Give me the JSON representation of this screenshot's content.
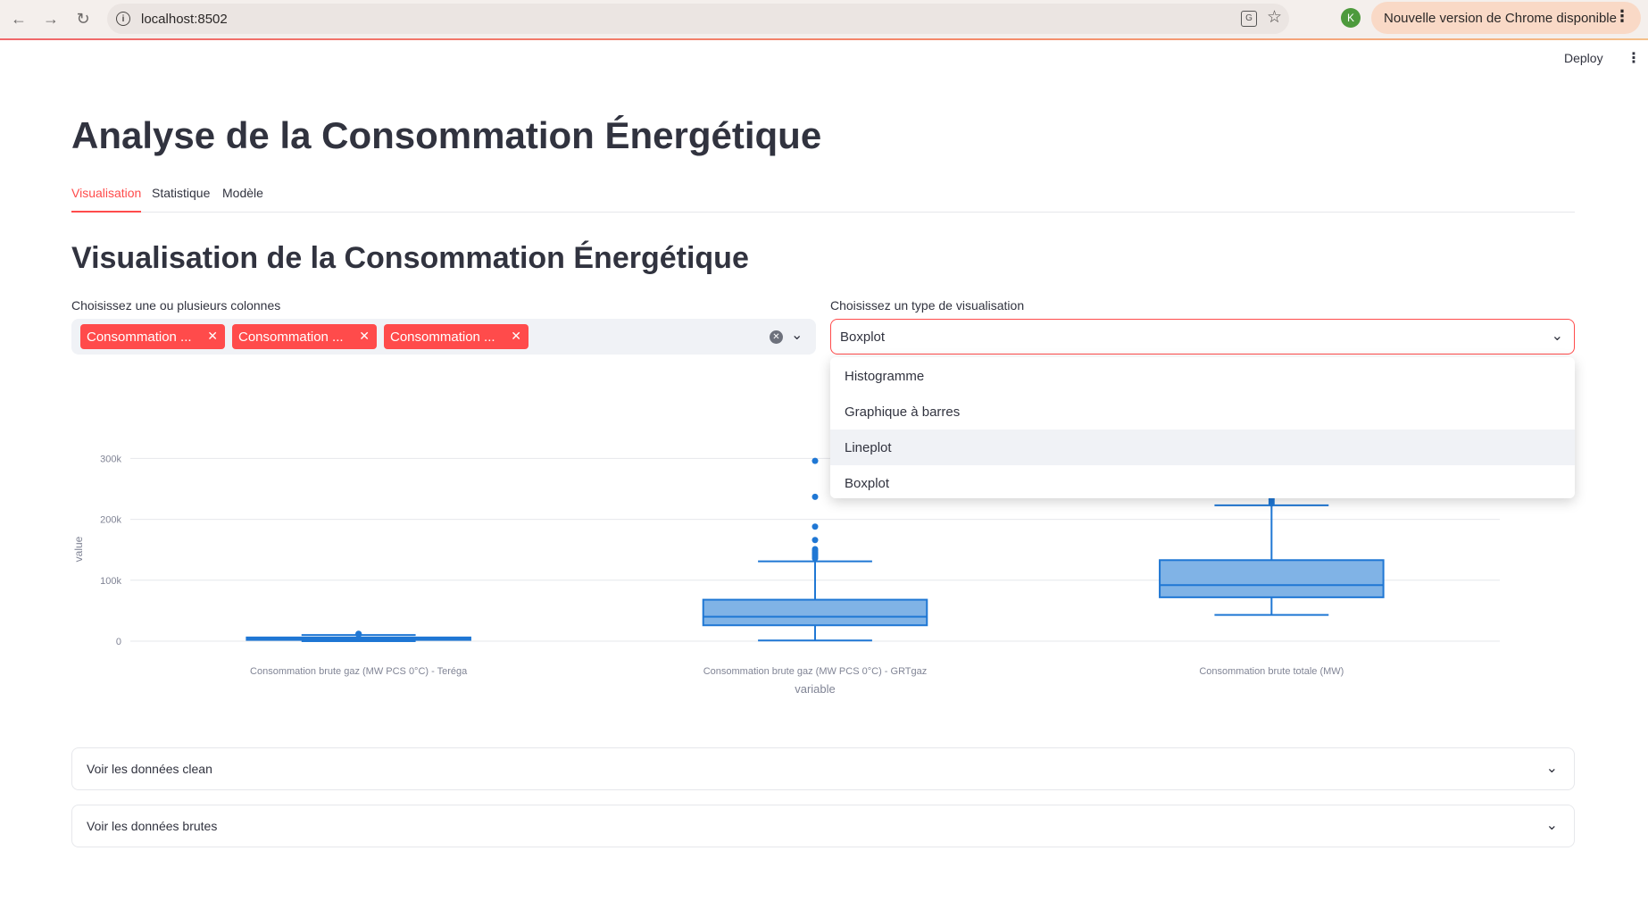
{
  "browser": {
    "url": "localhost:8502",
    "update_label": "Nouvelle version de Chrome disponible",
    "profile_initial": "K",
    "icons": [
      "back-icon",
      "forward-icon",
      "reload-icon",
      "site-info-icon",
      "translate-icon",
      "star-icon",
      "menu-dots-icon"
    ]
  },
  "header": {
    "deploy_label": "Deploy"
  },
  "app": {
    "title": "Analyse de la Consommation Énergétique",
    "tabs": [
      {
        "label": "Visualisation",
        "active": true
      },
      {
        "label": "Statistique",
        "active": false
      },
      {
        "label": "Modèle",
        "active": false
      }
    ],
    "section_title": "Visualisation de la Consommation Énergétique"
  },
  "columns_select": {
    "label": "Choisissez une ou plusieurs colonnes",
    "chips": [
      "Consommation ...",
      "Consommation ...",
      "Consommation ..."
    ]
  },
  "viz_select": {
    "label": "Choisissez un type de visualisation",
    "value": "Boxplot",
    "options": [
      "Histogramme",
      "Graphique à barres",
      "Lineplot",
      "Boxplot"
    ],
    "hovered": "Lineplot"
  },
  "chart_data": {
    "type": "box",
    "categories": [
      "Consommation brute gaz (MW PCS 0°C) - Teréga",
      "Consommation brute gaz (MW PCS 0°C) - GRTgaz",
      "Consommation brute totale (MW)"
    ],
    "xlabel": "variable",
    "ylabel": "value",
    "yticks": [
      "0",
      "100k",
      "200k",
      "300k"
    ],
    "ylim": [
      -3000,
      305000
    ],
    "color": "#1f77d4",
    "fill": "#80b3e6",
    "series": [
      {
        "min": 0,
        "q1": 2000,
        "median": 4000,
        "q3": 6000,
        "max": 10000,
        "outliers": [
          11000,
          11500,
          12000
        ]
      },
      {
        "min": 1000,
        "q1": 26000,
        "median": 40000,
        "q3": 68000,
        "max": 131000,
        "outliers": [
          136000,
          139000,
          142000,
          145000,
          148000,
          151000,
          166000,
          188000,
          237000,
          296000
        ]
      },
      {
        "min": 43000,
        "q1": 72000,
        "median": 92000,
        "q3": 133000,
        "max": 223000,
        "outliers": [
          226000,
          229000,
          232000,
          235000
        ]
      }
    ]
  },
  "expanders": [
    {
      "label": "Voir les données clean"
    },
    {
      "label": "Voir les données brutes"
    }
  ]
}
